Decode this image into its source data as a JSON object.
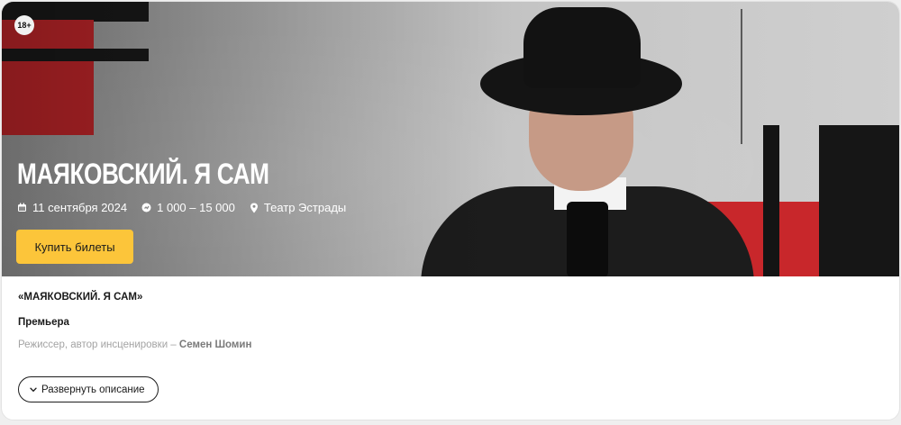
{
  "hero": {
    "age_badge": "18+",
    "title": "МАЯКОВСКИЙ. Я САМ",
    "date": "11 сентября 2024",
    "price": "1 000 – 15 000",
    "venue": "Театр Эстрады",
    "buy_label": "Купить билеты",
    "icons": {
      "date": "calendar-icon",
      "price": "price-tag-icon",
      "venue": "location-pin-icon"
    },
    "colors": {
      "accent": "#fcc53a",
      "red": "#c8272b",
      "black": "#161616"
    }
  },
  "description": {
    "quote_title": "«МАЯКОВСКИЙ. Я САМ»",
    "subtitle": "Премьера",
    "credit_role": "Режиссер, автор инсценировки – ",
    "credit_name": "Семен Шомин",
    "expand_label": "Развернуть описание",
    "expand_icon": "chevron-down-icon"
  }
}
